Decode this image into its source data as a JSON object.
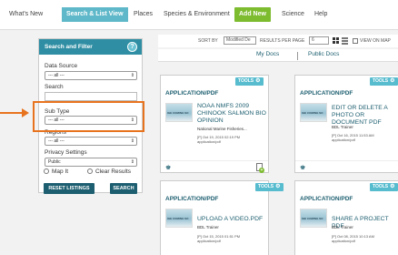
{
  "nav": {
    "items": [
      "What's New",
      "Search & List View",
      "Places",
      "Species & Environment",
      "Add New",
      "Science",
      "Help"
    ]
  },
  "sidebar": {
    "title": "Search and Filter",
    "help": "?",
    "data_source_label": "Data Source",
    "data_source_value": "--- all ---",
    "search_label": "Search",
    "sub_type_label": "Sub Type",
    "sub_type_value": "--- all ---",
    "regions_label": "Regions",
    "regions_value": "--- all ---",
    "privacy_label": "Privacy Settings",
    "privacy_value": "Public",
    "map_it": "Map It",
    "clear_results": "Clear Results",
    "reset_button": "RESET LISTINGS",
    "search_button": "SEARCH"
  },
  "sortbar": {
    "sort_by_label": "SORT BY",
    "sort_by_value": "Modified De",
    "per_page_label": "RESULTS PER PAGE",
    "per_page_value": "6",
    "view_on_map": "VIEW ON MAP"
  },
  "tabs": {
    "my_docs": "My Docs",
    "public_docs": "Public Docs"
  },
  "cards": [
    {
      "tools": "TOOLS",
      "type": "APPLICATION/PDF",
      "thumb_text": "IGE COMING SO",
      "title": "NOAA NMFS 2009 CHINOOK SALMON BIO OPINION",
      "owner": "National Marine Fisheries...",
      "date": "[P] Oct 19, 2015 02:19 PM",
      "mime": "application/pdf"
    },
    {
      "tools": "TOOLS",
      "type": "APPLICATION/PDF",
      "thumb_text": "IGE COMING SO",
      "title": "EDIT OR DELETE A PHOTO OR DOCUMENT PDF",
      "owner": "BDL Trainer",
      "date": "[P] Oct 16, 2015 11:53 AM",
      "mime": "application/pdf"
    },
    {
      "tools": "TOOLS",
      "type": "APPLICATION/PDF",
      "thumb_text": "IGE COMING SO",
      "title": "UPLOAD A VIDEO.PDF",
      "owner": "BDL Trainer",
      "date": "[P] Oct 15, 2015 01:51 PM",
      "mime": "application/pdf"
    },
    {
      "tools": "TOOLS",
      "type": "APPLICATION/PDF",
      "thumb_text": "IGE COMING SO",
      "title": "SHARE A PROJECT PDF",
      "owner": "BDL Trainer",
      "date": "[P] Oct 08, 2015 10:13 AM",
      "mime": "application/pdf"
    }
  ]
}
